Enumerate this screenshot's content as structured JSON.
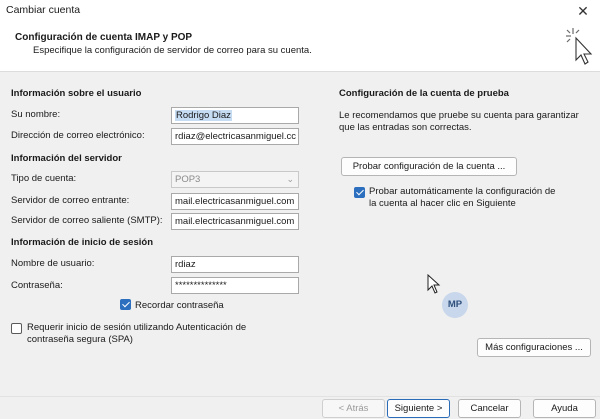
{
  "window": {
    "title": "Cambiar cuenta",
    "close_glyph": "✕"
  },
  "header": {
    "title": "Configuración de cuenta IMAP y POP",
    "subtitle": "Especifique la configuración de servidor de correo para su cuenta."
  },
  "user_info": {
    "heading": "Información sobre el usuario",
    "name_label": "Su nombre:",
    "name_value": "Rodrigo Diaz",
    "email_label": "Dirección de correo electrónico:",
    "email_value": "rdiaz@electricasanmiguel.cc"
  },
  "server_info": {
    "heading": "Información del servidor",
    "account_type_label": "Tipo de cuenta:",
    "account_type_value": "POP3",
    "incoming_label": "Servidor de correo entrante:",
    "incoming_value": "mail.electricasanmiguel.com",
    "outgoing_label": "Servidor de correo saliente (SMTP):",
    "outgoing_value": "mail.electricasanmiguel.com"
  },
  "login_info": {
    "heading": "Información de inicio de sesión",
    "username_label": "Nombre de usuario:",
    "username_value": "rdiaz",
    "password_label": "Contraseña:",
    "password_value": "**************",
    "remember_label": "Recordar contraseña",
    "remember_checked": true,
    "spa_label_line1": "Requerir inicio de sesión utilizando Autenticación de",
    "spa_label_line2": "contraseña segura (SPA)",
    "spa_checked": false
  },
  "test_settings": {
    "heading": "Configuración de la cuenta de prueba",
    "desc_line1": "Le recomendamos que pruebe su cuenta para garantizar",
    "desc_line2": "que las entradas son correctas.",
    "test_button": "Probar configuración de la cuenta ...",
    "auto_test_line1": "Probar automáticamente la configuración de",
    "auto_test_line2": "la cuenta al hacer clic en Siguiente",
    "auto_test_checked": true,
    "more_settings_button": "Más configuraciones ..."
  },
  "overlay": {
    "avatar_initials": "MP"
  },
  "footer": {
    "back": "< Atrás",
    "next": "Siguiente >",
    "cancel": "Cancelar",
    "help": "Ayuda"
  },
  "colors": {
    "accent": "#2c6fbf",
    "selection": "#c6dcf3"
  },
  "icons": [
    "close-icon",
    "setup-wand-icon",
    "dropdown-arrow-icon",
    "checkmark-icon",
    "mouse-pointer-icon"
  ]
}
